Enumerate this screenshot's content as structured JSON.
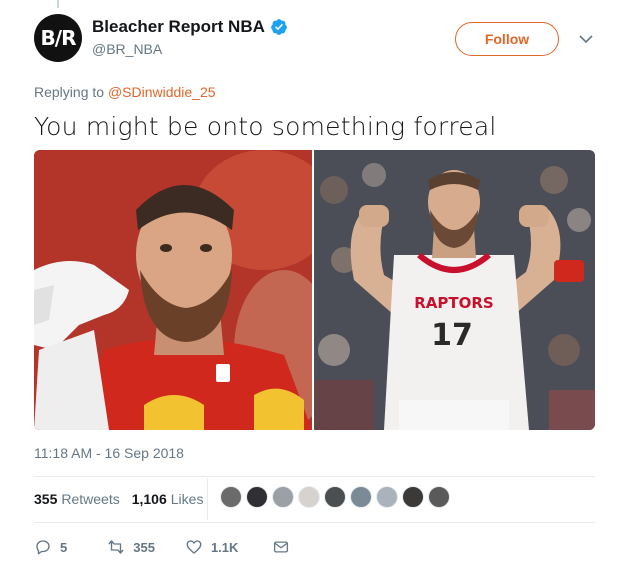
{
  "account": {
    "avatar_text": "B/R",
    "display_name": "Bleacher Report NBA",
    "verified": true,
    "handle": "@BR_NBA",
    "follow_label": "Follow",
    "brand_color": "#e0672a"
  },
  "reply": {
    "prefix": "Replying to",
    "mention": "@SDinwiddie_25"
  },
  "tweet_text": "You might be onto something forreal",
  "media": {
    "left_photo": "football-player-red-jersey",
    "right_photo": "raptors-player-17-flexing",
    "right_jersey_team": "RAPTORS",
    "right_jersey_number": "17"
  },
  "timestamp": "11:18 AM - 16 Sep 2018",
  "stats": {
    "retweets_count": "355",
    "retweets_label": "Retweets",
    "likes_count": "1,106",
    "likes_label": "Likes"
  },
  "liker_avatars": [
    "#6b6b6b",
    "#2f2f34",
    "#9aa0a6",
    "#d8d2cf",
    "#4c4f52",
    "#7c8a98",
    "#aab3bc",
    "#3c3a38",
    "#5a5a5a"
  ],
  "actions": {
    "replies": "5",
    "retweets": "355",
    "likes": "1.1K"
  }
}
